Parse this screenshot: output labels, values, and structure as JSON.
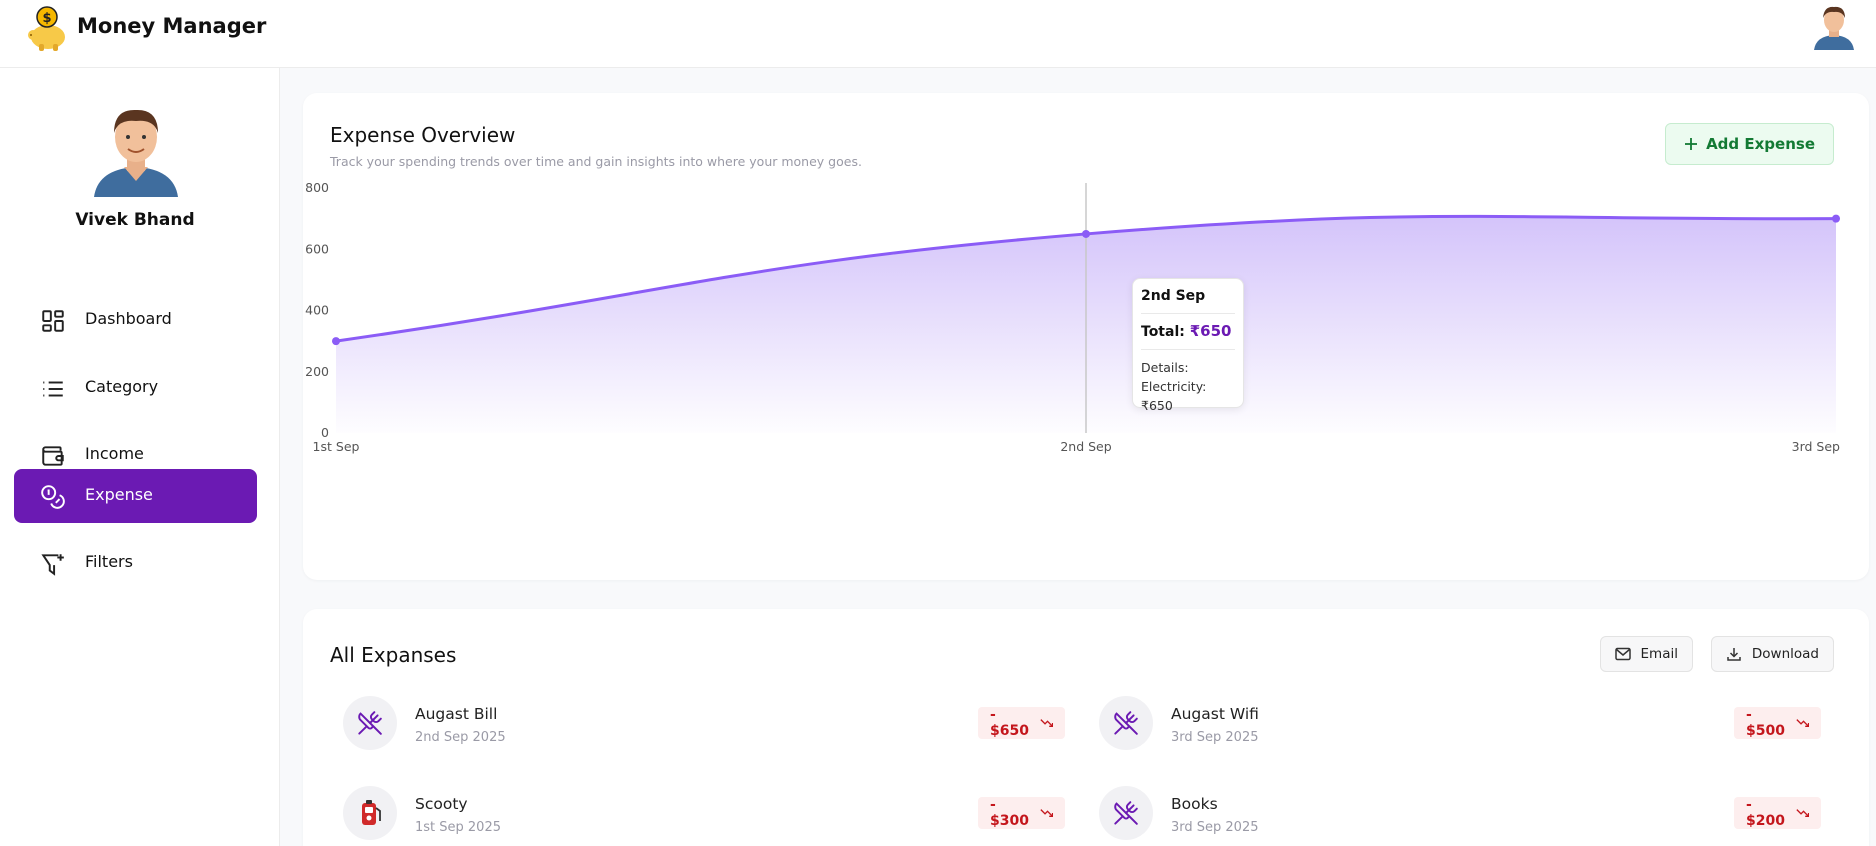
{
  "app": {
    "title": "Money Manager"
  },
  "icons": {
    "logo": "piggy-bank-icon",
    "header_avatar": "user-avatar"
  },
  "user": {
    "name": "Vivek Bhand"
  },
  "sidebar": {
    "items": [
      {
        "label": "Dashboard",
        "icon": "dashboard-icon",
        "active": false
      },
      {
        "label": "Category",
        "icon": "list-icon",
        "active": false
      },
      {
        "label": "Income",
        "icon": "wallet-icon",
        "active": false
      },
      {
        "label": "Expense",
        "icon": "coins-icon",
        "active": true
      },
      {
        "label": "Filters",
        "icon": "filter-icon",
        "active": false
      }
    ]
  },
  "overview": {
    "title": "Expense Overview",
    "subtitle": "Track your spending trends over time and gain insights into where your money goes.",
    "add_button": "Add Expense",
    "tooltip": {
      "date": "2nd Sep",
      "total_label": "Total:",
      "total_value": "₹650",
      "details_label": "Details:",
      "details_value": "Electricity:₹650"
    }
  },
  "chart_data": {
    "type": "area",
    "categories": [
      "1st Sep",
      "2nd Sep",
      "3rd Sep"
    ],
    "values": [
      300,
      650,
      700
    ],
    "yticks": [
      "0",
      "200",
      "400",
      "600",
      "800"
    ],
    "ylim": [
      0,
      800
    ],
    "color": "#8b5cf6"
  },
  "expenses": {
    "title": "All Expanses",
    "email_button": "Email",
    "download_button": "Download",
    "items": [
      {
        "name": "Augast Bill",
        "date": "2nd Sep 2025",
        "amount": "- $650",
        "icon": "utensils-icon"
      },
      {
        "name": "Augast Wifi",
        "date": "3rd Sep 2025",
        "amount": "- $500",
        "icon": "utensils-icon"
      },
      {
        "name": "Scooty",
        "date": "1st Sep 2025",
        "amount": "- $300",
        "icon": "fuel-pump-icon"
      },
      {
        "name": "Books",
        "date": "3rd Sep 2025",
        "amount": "- $200",
        "icon": "utensils-icon"
      }
    ]
  },
  "colors": {
    "accent": "#6b1ab3",
    "positive_bg": "#ecfbf0",
    "negative": "#c4161c"
  }
}
